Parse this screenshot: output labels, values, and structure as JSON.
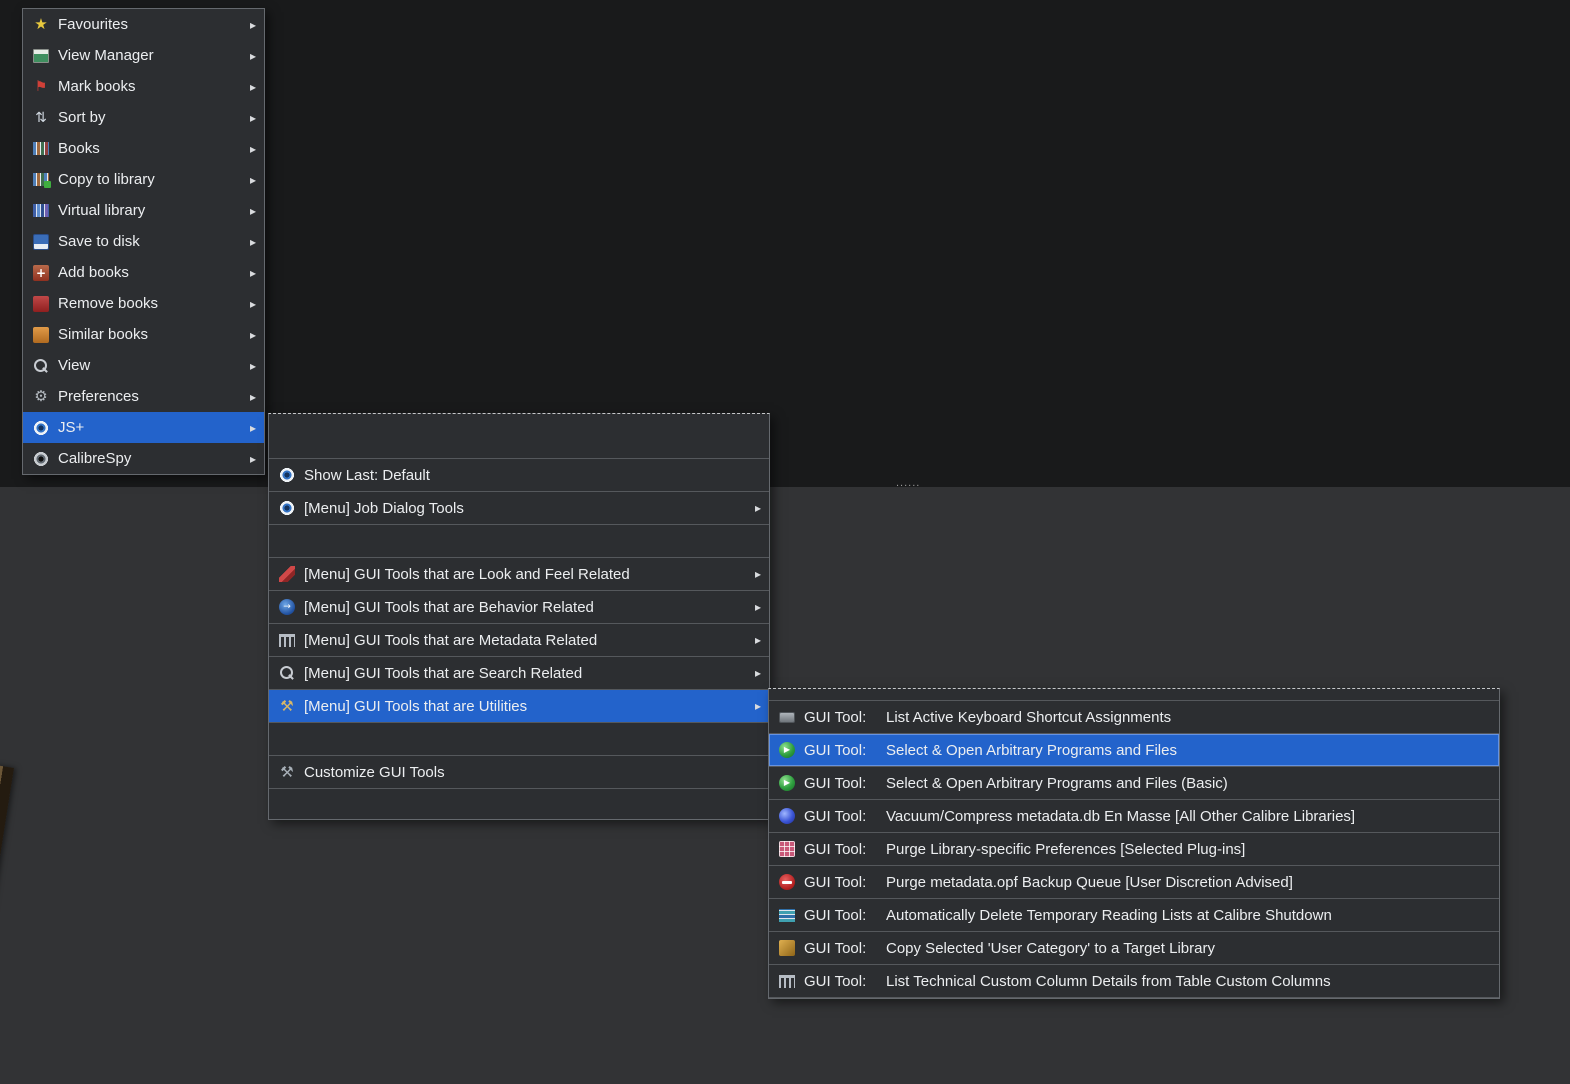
{
  "colors": {
    "highlight": "#2363cb",
    "menu_bg": "#2c2e31",
    "menu_border": "#65696e"
  },
  "background": {
    "splitter_dots": "......"
  },
  "glyphs": {
    "submenu_arrow": "▸",
    "star": "★",
    "flag": "⚑",
    "sort": "⇅",
    "plus": "+",
    "gear": "⚙",
    "tools": "⚒",
    "play": "▶",
    "arrow_right": "→"
  },
  "menu1": {
    "items": [
      {
        "label": "Favourites",
        "icon": "star",
        "arrow": true
      },
      {
        "label": "View Manager",
        "icon": "window",
        "arrow": true
      },
      {
        "label": "Mark books",
        "icon": "pin",
        "arrow": true
      },
      {
        "label": "Sort by",
        "icon": "sort",
        "arrow": true
      },
      {
        "label": "Books",
        "icon": "books",
        "arrow": true
      },
      {
        "label": "Copy to library",
        "icon": "copy-books",
        "arrow": true
      },
      {
        "label": "Virtual library",
        "icon": "virtual-library",
        "arrow": true
      },
      {
        "label": "Save to disk",
        "icon": "floppy-disk",
        "arrow": true
      },
      {
        "label": "Add books",
        "icon": "add-book",
        "arrow": true
      },
      {
        "label": "Remove books",
        "icon": "remove-book",
        "arrow": true
      },
      {
        "label": "Similar books",
        "icon": "similar-book",
        "arrow": true
      },
      {
        "label": "View",
        "icon": "magnifier",
        "arrow": true
      },
      {
        "label": "Preferences",
        "icon": "gear",
        "arrow": true
      },
      {
        "label": "JS+",
        "icon": "eye",
        "arrow": true,
        "selected": true
      },
      {
        "label": "CalibreSpy",
        "icon": "spy-eye",
        "arrow": true
      }
    ]
  },
  "menu2": {
    "items": [
      {
        "label": "Show Last: Default",
        "icon": "eye",
        "arrow": false
      },
      {
        "label": "[Menu] Job Dialog Tools",
        "icon": "eye",
        "arrow": true
      },
      {
        "label": "[Menu] GUI Tools that are Look and Feel Related",
        "icon": "paintbrush",
        "arrow": true
      },
      {
        "label": "[Menu] GUI Tools that are Behavior Related",
        "icon": "circular-arrow",
        "arrow": true
      },
      {
        "label": "[Menu] GUI Tools that are Metadata Related",
        "icon": "columns",
        "arrow": true
      },
      {
        "label": "[Menu] GUI Tools that are Search Related",
        "icon": "magnifier",
        "arrow": true
      },
      {
        "label": "[Menu] GUI Tools that are Utilities",
        "icon": "tools",
        "arrow": true,
        "selected": true
      },
      {
        "label": "Customize GUI Tools",
        "icon": "tools-gray",
        "arrow": false
      }
    ]
  },
  "menu3": {
    "prefix": "GUI Tool:",
    "items": [
      {
        "desc": "List Active Keyboard Shortcut Assignments",
        "icon": "keyboard"
      },
      {
        "desc": "Select & Open Arbitrary Programs and Files",
        "icon": "play",
        "selected": true
      },
      {
        "desc": "Select & Open Arbitrary Programs and Files (Basic)",
        "icon": "play"
      },
      {
        "desc": "Vacuum/Compress metadata.db En Masse [All Other Calibre Libraries]",
        "icon": "swirl"
      },
      {
        "desc": "Purge Library-specific Preferences [Selected Plug-ins]",
        "icon": "grid"
      },
      {
        "desc": "Purge metadata.opf Backup Queue [User Discretion Advised]",
        "icon": "no-entry"
      },
      {
        "desc": "Automatically Delete Temporary Reading Lists at Calibre Shutdown",
        "icon": "book-stack"
      },
      {
        "desc": "Copy Selected 'User Category' to a Target Library",
        "icon": "category-gold"
      },
      {
        "desc": "List Technical Custom Column Details from Table Custom Columns",
        "icon": "columns"
      }
    ]
  }
}
